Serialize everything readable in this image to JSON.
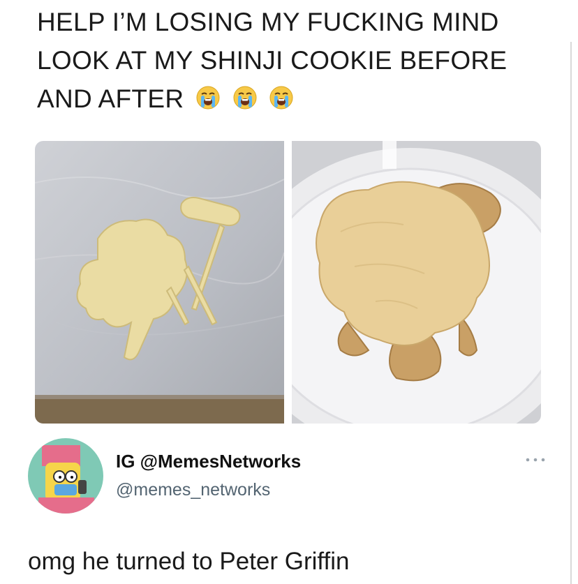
{
  "caption": {
    "line1": "HELP I’M LOSING MY FUCKING MIND",
    "line2": "LOOK AT MY SHINJI COOKIE BEFORE",
    "line3": "AND AFTER",
    "emoji": [
      "loudly-crying-face",
      "loudly-crying-face",
      "loudly-crying-face"
    ]
  },
  "images": [
    {
      "name": "before",
      "subject": "raw cookie dough on parchment paper"
    },
    {
      "name": "after",
      "subject": "baked cookie on a white plate"
    }
  ],
  "tweet": {
    "display_name": "IG @MemesNetworks",
    "handle": "@memes_networks",
    "text": "omg he turned to Peter Griffin",
    "more_icon": "ellipsis-icon"
  },
  "colors": {
    "handle": "#536471",
    "text": "#1a1a1a"
  }
}
